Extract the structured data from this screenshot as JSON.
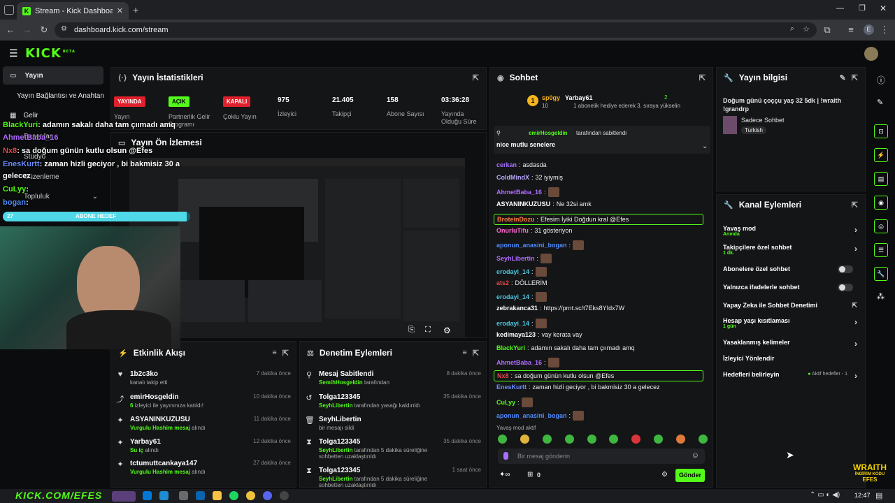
{
  "browser": {
    "tab_title": "Stream - Kick Dashboard",
    "url": "dashboard.kick.com/stream",
    "profile_initial": "E"
  },
  "app": {
    "logo": "KICK",
    "logo_sup": "BETA"
  },
  "sidebar": {
    "items": [
      {
        "label": "Yayın",
        "active": true
      },
      {
        "label": "Yayın Bağlantısı ve Anahtarı"
      },
      {
        "label": "Gelir"
      },
      {
        "label": "Başarılar"
      },
      {
        "label": "Stüdyo"
      },
      {
        "label": "Düzenleme"
      },
      {
        "label": "Topluluk"
      }
    ]
  },
  "stats_panel": {
    "title": "Yayın İstatistikleri",
    "stats": [
      {
        "badge": "YAYINDA",
        "label": "Yayın",
        "badge_color": "#e0202c"
      },
      {
        "badge": "AÇIK",
        "label": "Partnerlik Gelir Programı",
        "badge_color": "#53fc18"
      },
      {
        "badge": "KAPALI",
        "label": "Çoklu Yayın",
        "badge_color": "#e0202c"
      },
      {
        "value": "975",
        "label": "İzleyici"
      },
      {
        "value": "21.405",
        "label": "Takipçi"
      },
      {
        "value": "158",
        "label": "Abone Sayısı"
      },
      {
        "value": "03:36:28",
        "label": "Yayında Olduğu Süre"
      }
    ]
  },
  "preview_panel": {
    "title": "Yayın Ön İzlemesi"
  },
  "activity_panel": {
    "title": "Etkinlik Akışı",
    "items": [
      {
        "icon": "heart-icon",
        "name": "1b2c3ko",
        "desc": "kanalı takip etti",
        "time": "7 dakika önce"
      },
      {
        "icon": "raid-icon",
        "name": "emirHosgeldin",
        "desc_hl": "6",
        "desc": " izleyici ile yayınınıza katıldı!",
        "time": "10 dakika önce"
      },
      {
        "icon": "gift-icon",
        "name": "ASYANINKUZUSU",
        "desc_hl": "Vurgulu Hashim mesaj",
        "desc": " alındı",
        "time": "11 dakika önce"
      },
      {
        "icon": "gift-icon",
        "name": "Yarbay61",
        "desc_hl": "Su iç",
        "desc": " alındı",
        "time": "12 dakika önce"
      },
      {
        "icon": "gift-icon",
        "name": "tctumuttcankaya147",
        "desc_hl": "Vurgulu Hashim mesaj",
        "desc": " alındı",
        "time": "27 dakika önce"
      }
    ]
  },
  "moderation_panel": {
    "title": "Denetim Eylemleri",
    "items": [
      {
        "icon": "pin-icon",
        "name": "Mesaj Sabitlendi",
        "desc_hl": "SemihHosgeldin",
        "desc": " tarafından",
        "time": "8 dakika önce"
      },
      {
        "icon": "undo-icon",
        "name": "Tolga123345",
        "desc_hl": "SeyhLibertin",
        "desc": " tarafından yasağı kaldırıldı",
        "time": "35 dakika önce"
      },
      {
        "icon": "trash-icon",
        "name": "SeyhLibertin",
        "desc": "bir mesajı sildi",
        "time": ""
      },
      {
        "icon": "hourglass-icon",
        "name": "Tolga123345",
        "desc_hl": "SeyhLibertin",
        "desc": " tarafından 5 dakika süreliğine sohbetten uzaklaştırıldı",
        "time": "35 dakika önce"
      },
      {
        "icon": "hourglass-icon",
        "name": "Tolga123345",
        "desc_hl": "SeyhLibertin",
        "desc": " tarafından 5 dakika süreliğine sohbetten uzaklaştırıldı",
        "time": "1 saat önce"
      }
    ]
  },
  "chat": {
    "title": "Sohbet",
    "gift": {
      "user1": "sp0gy",
      "count1": "10",
      "user2": "Yarbay61",
      "count2": "2",
      "msg": "1 abonelik hediye ederek 3. sıraya yükselin",
      "rank": "1"
    },
    "pinned": {
      "by": "emirHosgeldin",
      "suffix": "tarafından sabitlendi",
      "text": "nice mutlu senelere"
    },
    "messages": [
      {
        "user": "cerkan",
        "color": "#a770ff",
        "text": "asdasda"
      },
      {
        "user": "ColdMindX",
        "color": "#b9a9ff",
        "text": "32 iyiymiş"
      },
      {
        "user": "AhmetBaba_16",
        "color": "#b06cff",
        "text": ""
      },
      {
        "user": "ASYANINKUZUSU",
        "color": "#ffffff",
        "text": "Ne 32si amk"
      },
      {
        "user": "BroteinDozu",
        "color": "#ff7b3a",
        "text": "Efesim İyiki Doğdun kral @Efes",
        "hl": true
      },
      {
        "user": "OnurluTifu",
        "color": "#ff6ad5",
        "text": "31 gösteriyon"
      },
      {
        "user": "aponun_anasini_bogan",
        "color": "#4f8cff",
        "text": ""
      },
      {
        "user": "SeyhLibertin",
        "color": "#b06cff",
        "text": ""
      },
      {
        "user": "erodayi_14",
        "color": "#4cc6e0",
        "text": ""
      },
      {
        "user": "ats2",
        "color": "#e04848",
        "text": "DÖLLERİM"
      },
      {
        "user": "erodayi_14",
        "color": "#4cc6e0",
        "text": ""
      },
      {
        "user": "zebrakanca31",
        "color": "#ffffff",
        "text": "https://prnt.sc/t7Eks8YIdx7W"
      },
      {
        "user": "erodayi_14",
        "color": "#4cc6e0",
        "text": ""
      },
      {
        "user": "kedimaya123",
        "color": "#ffffff",
        "text": "vay kerata vay"
      },
      {
        "user": "BlackYuri",
        "color": "#53fc18",
        "text": "adamın sakalı daha tam çıımadı amq"
      },
      {
        "user": "AhmetBaba_16",
        "color": "#b06cff",
        "text": ""
      },
      {
        "user": "Nx8",
        "color": "#e04848",
        "text": "sa doğum günün kutlu olsun @Efes",
        "hl": true
      },
      {
        "user": "EnesKurtt",
        "color": "#6a8cff",
        "text": "zaman hizli geciyor , bi bakmisiz 30 a gelecez"
      },
      {
        "user": "CuLyy",
        "color": "#53fc18",
        "text": ""
      },
      {
        "user": "aponun_anasini_bogan",
        "color": "#4f8cff",
        "text": ""
      }
    ],
    "slow_mode": "Yavaş mod aktif",
    "input_placeholder": "Bir mesaj gönderin",
    "send_label": "Gönder",
    "points": "0"
  },
  "stream_info": {
    "title": "Yayın bilgisi",
    "stream_title": "Doğum günü çoççu yaş 32 5dk | !wraith !grandrp",
    "category": "Sadece Sohbet",
    "tag": "Turkish"
  },
  "channel_actions": {
    "title": "Kanal Eylemleri",
    "items": [
      {
        "label": "Yavaş mod",
        "sub": "Anında",
        "control": "chevron"
      },
      {
        "label": "Takipçilere özel sohbet",
        "sub": "1 dk.",
        "control": "chevron"
      },
      {
        "label": "Abonelere özel sohbet",
        "control": "toggle"
      },
      {
        "label": "Yalnızca ifadelerle sohbet",
        "control": "toggle"
      },
      {
        "label": "Yapay Zeka ile Sohbet Denetimi",
        "control": "external"
      },
      {
        "label": "Hesap yaşı kısıtlaması",
        "sub": "1 gün",
        "control": "chevron"
      },
      {
        "label": "Yasaklanmış kelimeler",
        "control": "chevron"
      },
      {
        "label": "İzleyici Yönlendir",
        "control": "none"
      },
      {
        "label": "Hedefleri belirleyin",
        "status": "Aktif hedefler - 1",
        "control": "chevron"
      }
    ]
  },
  "overlay": {
    "chat_lines": [
      {
        "user": "BlackYuri",
        "text": ": adamın sakalı daha tam çıımadı amq"
      },
      {
        "user": "AhmetBaba_16",
        "text": ""
      },
      {
        "user": "Nx8",
        "text": ": sa doğum günün kutlu olsun @Efes"
      },
      {
        "user": "EnesKurtt",
        "text": ": zaman hizli geciyor , bi bakmisiz 30 a"
      },
      {
        "user": "",
        "text": "gelecez"
      },
      {
        "user": "CuLyy",
        "text": ":"
      },
      {
        "user": "bogan",
        "text": ":"
      }
    ],
    "goal_left": "27",
    "goal_label": "ABONE HEDEF",
    "goal_progress": 0.98,
    "channel_url": "KICK.COM/EFES",
    "brand1": "WRAITH",
    "brand2": "İNDİRİM KODU",
    "brand3": "EFES"
  },
  "taskbar": {
    "time": "12:47"
  },
  "colors": {
    "accent": "#53fc18",
    "live": "#e0202c",
    "panel": "#141517"
  }
}
